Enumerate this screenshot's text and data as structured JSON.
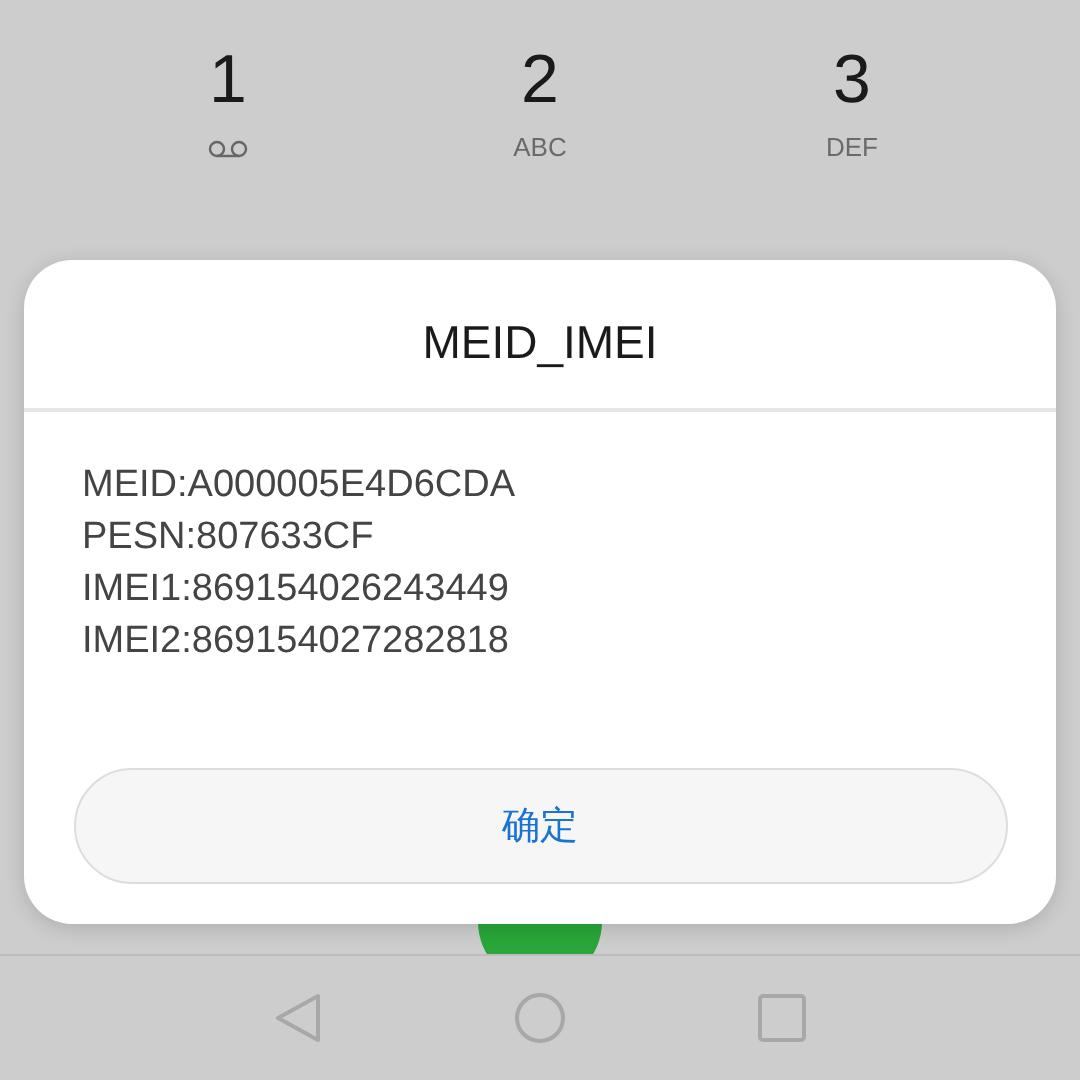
{
  "keypad": [
    {
      "digit": "1",
      "kind": "voicemail"
    },
    {
      "digit": "2",
      "sub": "ABC",
      "kind": "letters"
    },
    {
      "digit": "3",
      "sub": "DEF",
      "kind": "letters"
    }
  ],
  "dialog": {
    "title": "MEID_IMEI",
    "lines": [
      "MEID:A000005E4D6CDA",
      "PESN:807633CF",
      "IMEI1:869154026243449",
      "IMEI2:869154027282818"
    ],
    "button": "确定"
  }
}
